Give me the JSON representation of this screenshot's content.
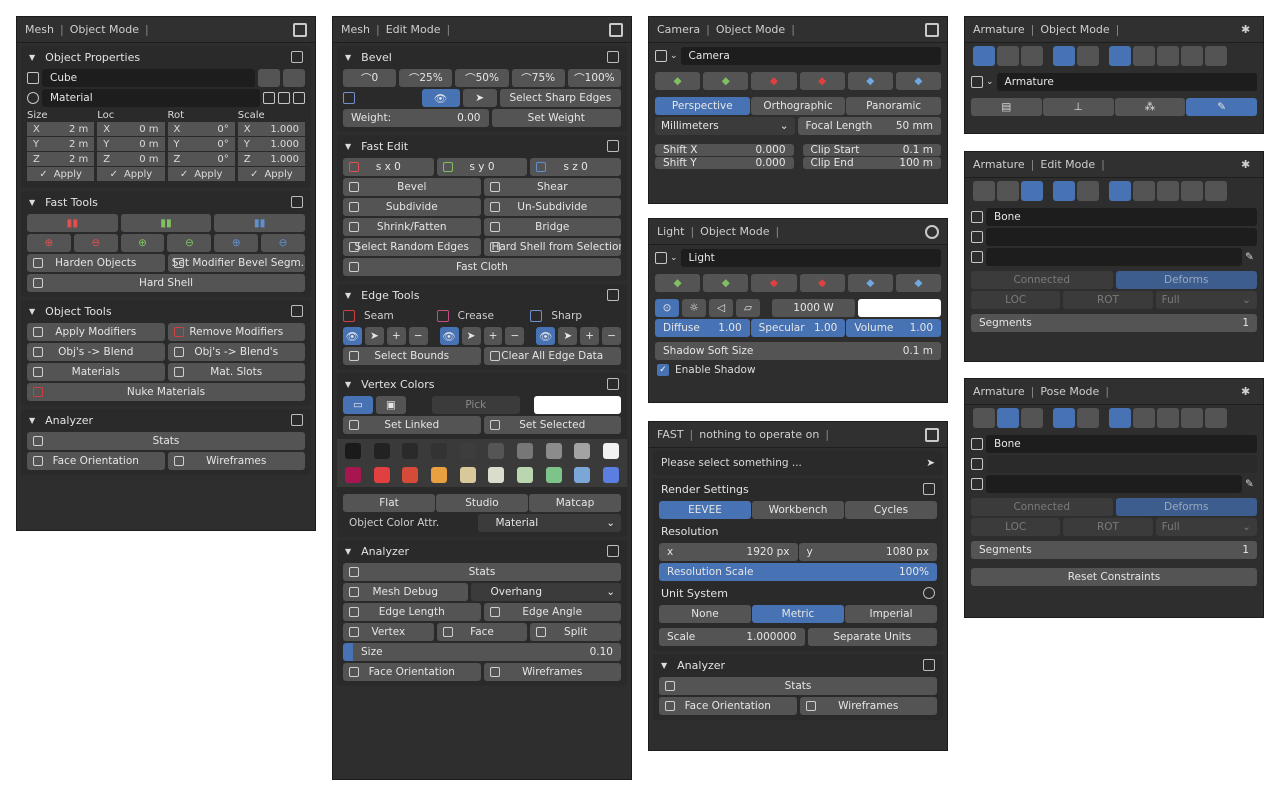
{
  "p1": {
    "h1": "Mesh",
    "h2": "Object Mode",
    "objprops": {
      "title": "Object Properties",
      "obj": "Cube",
      "mat": "Material",
      "cols": [
        {
          "cap": "Size",
          "x": "2 m",
          "y": "2 m",
          "z": "2 m"
        },
        {
          "cap": "Loc",
          "x": "0 m",
          "y": "0 m",
          "z": "0 m"
        },
        {
          "cap": "Rot",
          "x": "0°",
          "y": "0°",
          "z": "0°"
        },
        {
          "cap": "Scale",
          "x": "1.000",
          "y": "1.000",
          "z": "1.000"
        }
      ],
      "apply": "Apply"
    },
    "fast": {
      "title": "Fast Tools",
      "harden": "Harden Objects",
      "setmod": "Set Modifier Bevel Segm...",
      "hardshell": "Hard Shell"
    },
    "objtools": {
      "title": "Object Tools",
      "apply": "Apply Modifiers",
      "remove": "Remove Modifiers",
      "toblend": "Obj's -> Blend",
      "toblends": "Obj's -> Blend's",
      "mats": "Materials",
      "matslots": "Mat. Slots",
      "nuke": "Nuke Materials"
    },
    "analyzer": {
      "title": "Analyzer",
      "stats": "Stats",
      "face": "Face Orientation",
      "wire": "Wireframes"
    }
  },
  "p2": {
    "h1": "Mesh",
    "h2": "Edit Mode",
    "bevel": {
      "title": "Bevel",
      "presets": [
        "0",
        "25%",
        "50%",
        "75%",
        "100%"
      ],
      "sharp": "Select Sharp Edges",
      "weight_label": "Weight:",
      "weight": "0.00",
      "setw": "Set Weight"
    },
    "fastedit": {
      "title": "Fast Edit",
      "sx": "s x 0",
      "sy": "s y 0",
      "sz": "s z 0",
      "bevel": "Bevel",
      "shear": "Shear",
      "sub": "Subdivide",
      "unsub": "Un-Subdivide",
      "shrink": "Shrink/Fatten",
      "bridge": "Bridge",
      "rand": "Select Random Edges",
      "hardsel": "Hard Shell from Selection",
      "cloth": "Fast Cloth"
    },
    "edgetools": {
      "title": "Edge Tools",
      "seam": "Seam",
      "crease": "Crease",
      "sharp": "Sharp",
      "bounds": "Select Bounds",
      "clear": "Clear All Edge Data"
    },
    "vcol": {
      "title": "Vertex Colors",
      "pick": "Pick",
      "linked": "Set Linked",
      "selected": "Set Selected",
      "flat": "Flat",
      "studio": "Studio",
      "matcap": "Matcap",
      "attr_label": "Object Color Attr.",
      "attr": "Material",
      "row1": [
        "#1a1a1a",
        "#222222",
        "#2a2a2a",
        "#333333",
        "#3d3d3d",
        "#555555",
        "#777777",
        "#8c8c8c",
        "#a3a3a3",
        "#f2f2f2"
      ],
      "row2": [
        "#a8164f",
        "#e04040",
        "#d64a3a",
        "#e8a040",
        "#d9c89a",
        "#dcdccc",
        "#b9d6b0",
        "#7cc48a",
        "#7aa6d8",
        "#5a7fe0"
      ]
    },
    "analyzer": {
      "title": "Analyzer",
      "stats": "Stats",
      "debug": "Mesh Debug",
      "overhang": "Overhang",
      "elen": "Edge Length",
      "eang": "Edge Angle",
      "vertex": "Vertex",
      "face": "Face",
      "split": "Split",
      "size_label": "Size",
      "size": "0.10",
      "faceor": "Face Orientation",
      "wire": "Wireframes"
    }
  },
  "p3": {
    "h1": "Camera",
    "h2": "Object Mode",
    "name": "Camera",
    "persp": "Perspective",
    "ortho": "Orthographic",
    "pano": "Panoramic",
    "unit": "Millimeters",
    "focal_label": "Focal Length",
    "focal": "50 mm",
    "shiftx_label": "Shift X",
    "shiftx": "0.000",
    "shifty_label": "Shift Y",
    "shifty": "0.000",
    "cs_label": "Clip Start",
    "cs": "0.1 m",
    "ce_label": "Clip End",
    "ce": "100 m"
  },
  "p4": {
    "h1": "Light",
    "h2": "Object Mode",
    "name": "Light",
    "power": "1000 W",
    "diff_label": "Diffuse",
    "diff": "1.00",
    "spec_label": "Specular",
    "spec": "1.00",
    "vol_label": "Volume",
    "vol": "1.00",
    "soft_label": "Shadow Soft Size",
    "soft": "0.1 m",
    "shadow": "Enable Shadow"
  },
  "p5": {
    "h1": "FAST",
    "h2": "nothing to operate on",
    "msg": "Please select something ...",
    "render": "Render Settings",
    "eevee": "EEVEE",
    "wb": "Workbench",
    "cycles": "Cycles",
    "res": "Resolution",
    "x_label": "x",
    "x": "1920 px",
    "y_label": "y",
    "y": "1080 px",
    "rs_label": "Resolution Scale",
    "rs": "100%",
    "units": "Unit System",
    "none": "None",
    "metric": "Metric",
    "imperial": "Imperial",
    "scale_label": "Scale",
    "scale": "1.000000",
    "sep": "Separate Units",
    "analyzer": "Analyzer",
    "stats": "Stats",
    "face": "Face Orientation",
    "wire": "Wireframes"
  },
  "p6": {
    "h1": "Armature",
    "h2": "Object Mode",
    "name": "Armature"
  },
  "p7": {
    "h1": "Armature",
    "h2": "Edit Mode",
    "bone": "Bone",
    "connected": "Connected",
    "deforms": "Deforms",
    "loc": "LOC",
    "rot": "ROT",
    "full": "Full",
    "seg_label": "Segments",
    "seg": "1"
  },
  "p8": {
    "h1": "Armature",
    "h2": "Pose Mode",
    "bone": "Bone",
    "connected": "Connected",
    "deforms": "Deforms",
    "loc": "LOC",
    "rot": "ROT",
    "full": "Full",
    "seg_label": "Segments",
    "seg": "1",
    "reset": "Reset Constraints"
  },
  "colors": {
    "accent": "#4772b3",
    "panel": "#2e2e2e",
    "button": "#545454"
  }
}
